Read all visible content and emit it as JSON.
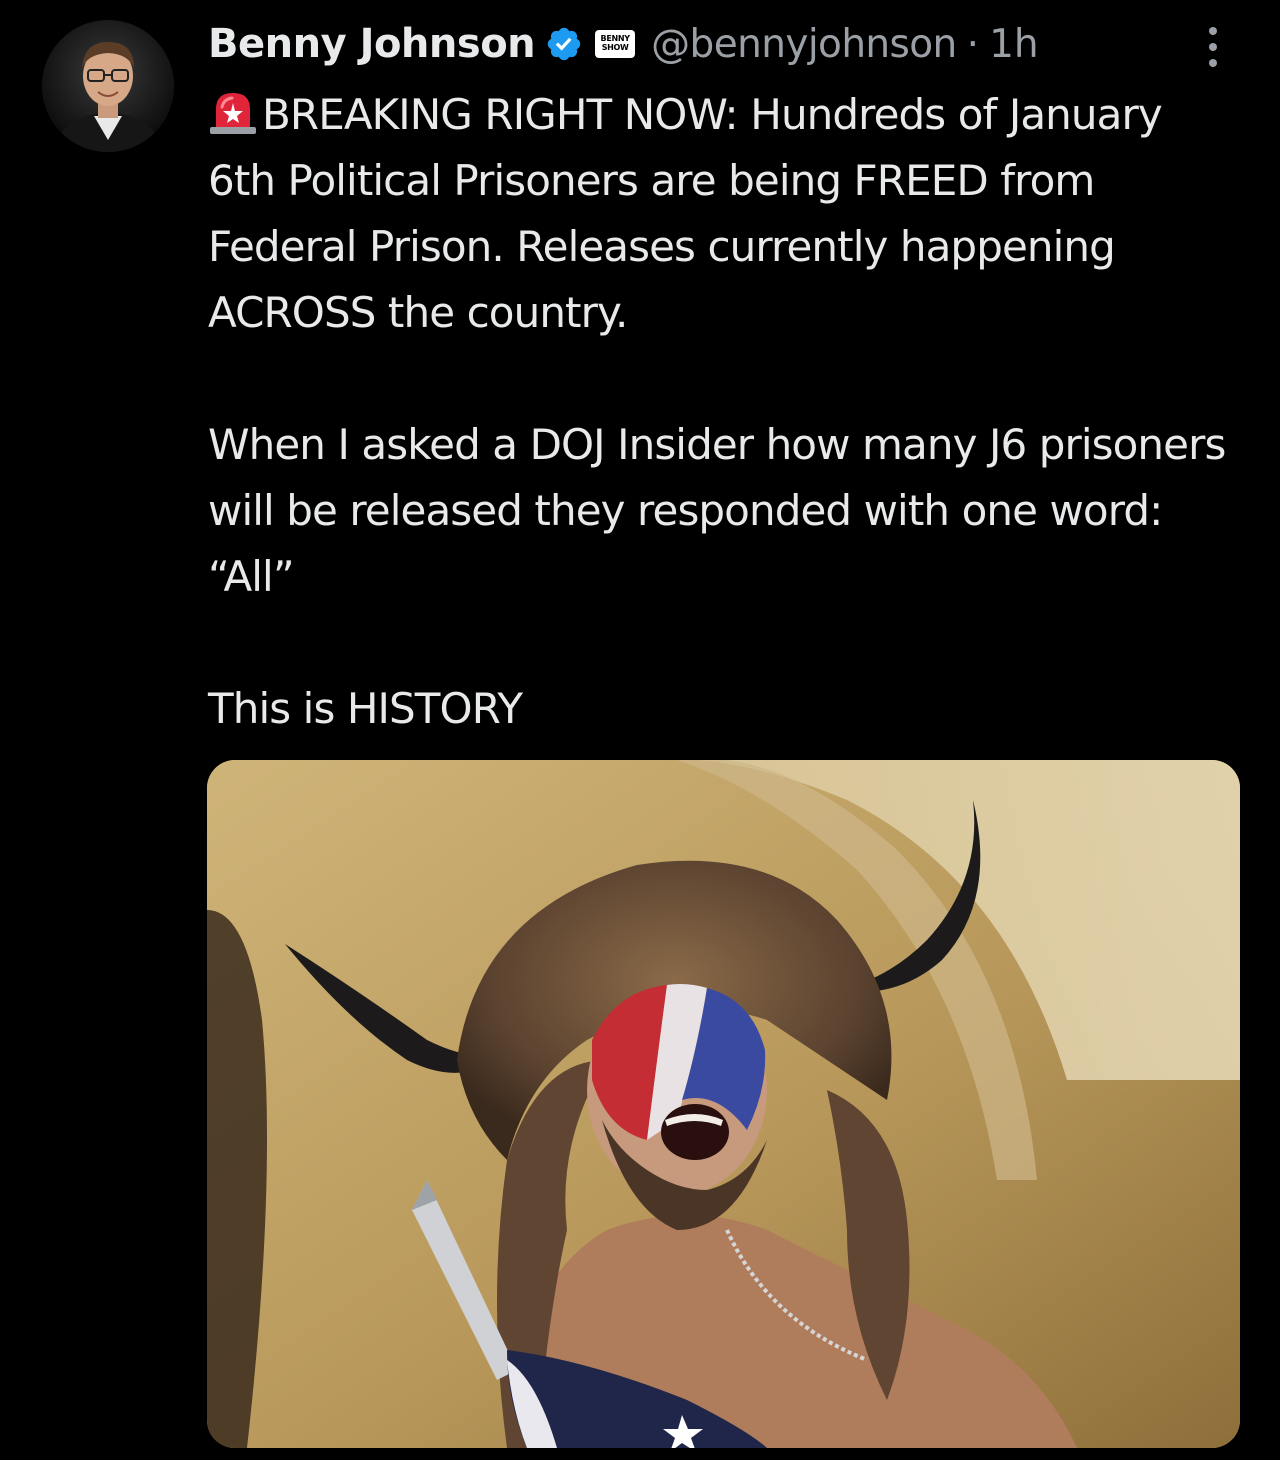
{
  "tweet": {
    "author": {
      "display_name": "Benny Johnson",
      "handle": "@bennyjohnson",
      "verified": true,
      "affiliate_badge_text": [
        "BENNY",
        "SHOW"
      ]
    },
    "separator": "·",
    "timestamp": "1h",
    "text": {
      "line1": "BREAKING RIGHT NOW: Hundreds of January 6th Political Prisoners are being FREED from Federal Prison. Releases currently happening ACROSS the country.",
      "line2": "When I asked a DOJ Insider how many J6 prisoners will be released they responded with one word: “All”",
      "line3": "This is HISTORY"
    },
    "icons": {
      "siren": "police-siren-emoji",
      "verified": "verified-checkmark-icon",
      "more": "more-vertical-icon"
    },
    "colors": {
      "background": "#000000",
      "text": "#e7e9ea",
      "secondary": "#9aa0a6",
      "verified": "#1d9bf0"
    },
    "media": {
      "type": "photo"
    }
  }
}
